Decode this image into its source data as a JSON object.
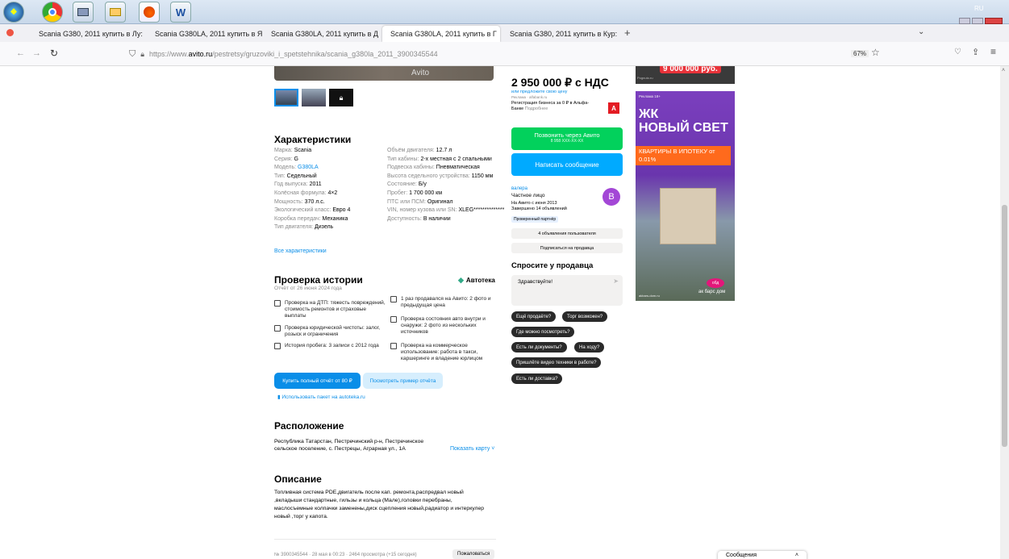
{
  "taskbar": {
    "lang": "RU"
  },
  "tabs": [
    {
      "label": "Scania G380, 2011 купить в Лу:"
    },
    {
      "label": "Scania G380LA, 2011 купить в Я"
    },
    {
      "label": "Scania G380LA, 2011 купить в Д"
    },
    {
      "label": "Scania G380LA, 2011 купить в Г"
    },
    {
      "label": "Scania G380, 2011 купить в Кур:"
    }
  ],
  "nav": {
    "url_prefix": "https://www.",
    "url_domain": "avito.ru",
    "url_path": "/pestretsy/gruzoviki_i_spetstehnika/scania_g380la_2011_3900345544",
    "zoom": "67%"
  },
  "gallery": {
    "watermark": "Avito"
  },
  "price": {
    "value": "2 950 000 ₽ с НДС",
    "offer": "или предложите свою цену",
    "ad_label": "Реклама · alfabank.ru",
    "ad_text": "Регистрация бизнеса за 0 ₽ в Альфа-Банке",
    "ad_more": "Подробнее",
    "bank_letter": "А"
  },
  "call": {
    "label": "Позвонить через Авито",
    "phone": "8 958 XXX-XX-XX"
  },
  "message_btn": "Написать сообщение",
  "seller": {
    "name": "валера",
    "type": "Частное лицо",
    "since": "На Авито с июня 2013",
    "completed": "Завершено 14 объявлений",
    "badge": "Проверенный партнёр",
    "avatar": "В",
    "listings_btn": "4 объявления пользователя",
    "subscribe_btn": "Подписаться на продавца"
  },
  "ask": {
    "title": "Спросите у продавца",
    "placeholder": "Здравствуйте!",
    "chips": [
      "Ещё продаёте?",
      "Торг возможен?",
      "Где можно посмотреть?",
      "Есть ли документы?",
      "На ходу?",
      "Пришлёте видео техники в работе?",
      "Есть ли доставка?"
    ]
  },
  "banner": {
    "top_price": "9 000 000 руб.",
    "top_label": "Pognuto.ru",
    "ad": "Реклама 18+",
    "title1": "ЖК",
    "title2": "НОВЫЙ СВЕТ",
    "offer": "КВАРТИРЫ В ИПОТЕКУ от 0.01%",
    "tag": "обд",
    "brand": "ак барс дом",
    "domain": "akbars-dom.ru"
  },
  "specs": {
    "title": "Характеристики",
    "left": [
      {
        "k": "Марка:",
        "v": "Scania"
      },
      {
        "k": "Серия:",
        "v": "G"
      },
      {
        "k": "Модель:",
        "v": "G380LA"
      },
      {
        "k": "Тип:",
        "v": "Седельный"
      },
      {
        "k": "Год выпуска:",
        "v": "2011"
      },
      {
        "k": "Колёсная формула:",
        "v": "4×2"
      },
      {
        "k": "Мощность:",
        "v": "370 л.с."
      },
      {
        "k": "Экологический класс:",
        "v": "Евро 4"
      },
      {
        "k": "Коробка передач:",
        "v": "Механика"
      },
      {
        "k": "Тип двигателя:",
        "v": "Дизель"
      }
    ],
    "right": [
      {
        "k": "Объём двигателя:",
        "v": "12.7 л"
      },
      {
        "k": "Тип кабины:",
        "v": "2-х местная с 2 спальными"
      },
      {
        "k": "Подвеска кабины:",
        "v": "Пневматическая"
      },
      {
        "k": "Высота седельного устройства:",
        "v": "1150 мм"
      },
      {
        "k": "Состояние:",
        "v": "Б/у"
      },
      {
        "k": "Пробег:",
        "v": "1 700 000 км"
      },
      {
        "k": "ПТС или ПСМ:",
        "v": "Оригинал"
      },
      {
        "k": "VIN, номер кузова или SN:",
        "v": "XLEG**************"
      },
      {
        "k": "Доступность:",
        "v": "В наличии"
      }
    ],
    "all_link": "Все характеристики"
  },
  "history": {
    "title": "Проверка истории",
    "brand": "Автотека",
    "date": "Отчёт от 26 июня 2024 года",
    "items_left": [
      "Проверка на ДТП: тяжесть повреждений, стоимость ремонтов и страховые выплаты",
      "Проверка юридической чистоты: залог, розыск и ограничения",
      "История пробега: 3 записи с 2012 года"
    ],
    "items_right": [
      "1 раз продавался на Авито: 2 фото и предыдущая цена",
      "Проверка состояния авто внутри и снаружи: 2 фото из нескольких источников",
      "Проверка на коммерческое использование: работа в такси, каршеринге и владение юрлицом"
    ],
    "buy_btn": "Купить полный отчёт от 80 ₽",
    "sample_btn": "Посмотреть пример отчёта",
    "package_link": "Использовать пакет на autoteka.ru"
  },
  "location": {
    "title": "Расположение",
    "address": "Республика Татарстан, Пестречинский р-н, Пестречинское сельское поселение, с. Пестрецы, Аграрная ул., 1А",
    "map_link": "Показать карту"
  },
  "description": {
    "title": "Описание",
    "text": "Топливная система PDE,двигатель после кап. ремонта,распредвал новый ,вкладыши стандартные, гильзы и кольца (Мале),головки перебраны, маслосъемные колпачки заменены,диск сцепления новый,радиатор и интеркулер новый ,торг у капота."
  },
  "footer": {
    "meta": "№ 3900345544 · 28 мая в 00:23 · 2464 просмотра (+15 сегодня)",
    "report": "Пожаловаться",
    "messages": "Сообщения"
  }
}
